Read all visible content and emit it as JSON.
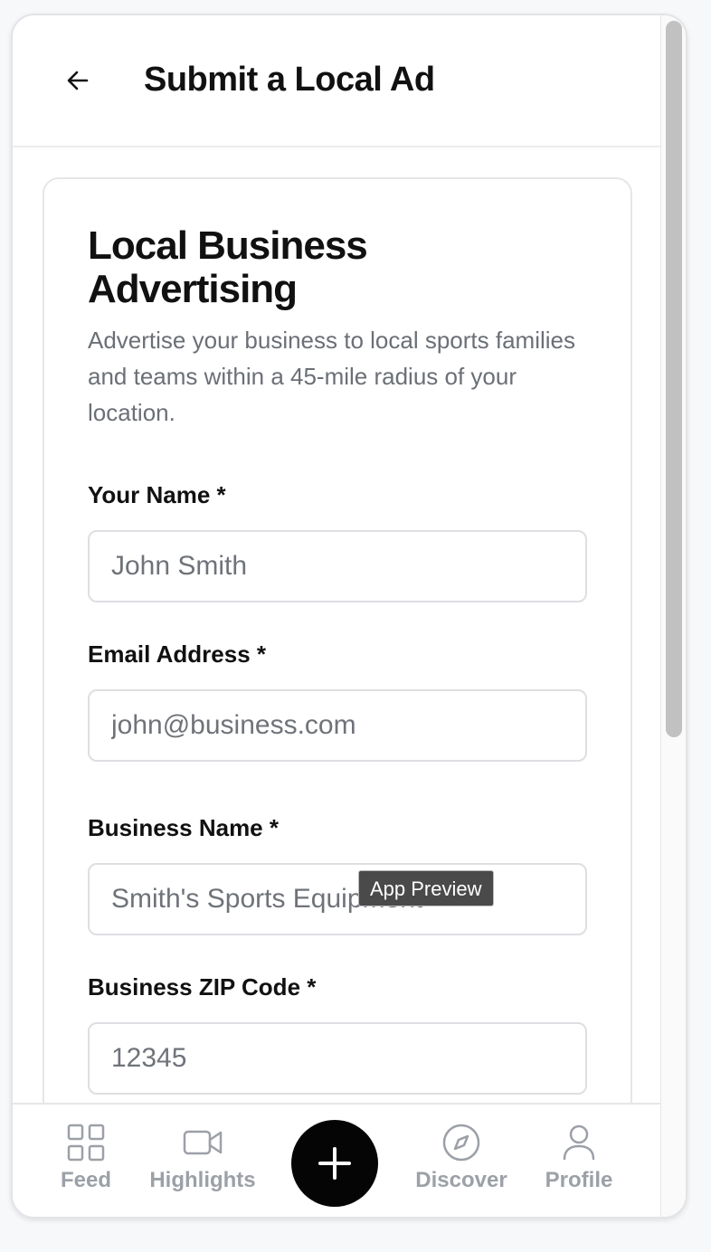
{
  "header": {
    "title": "Submit a Local Ad"
  },
  "card": {
    "title": "Local Business Advertising",
    "description": "Advertise your business to local sports families and teams within a 45-mile radius of your location."
  },
  "form": {
    "your_name": {
      "label": "Your Name *",
      "placeholder": "John Smith"
    },
    "email": {
      "label": "Email Address *",
      "placeholder": "john@business.com"
    },
    "business_name": {
      "label": "Business Name *",
      "placeholder": "Smith's Sports Equipment"
    },
    "zip": {
      "label": "Business ZIP Code *",
      "placeholder": "12345"
    }
  },
  "tooltip": {
    "text": "App Preview"
  },
  "nav": {
    "items": [
      {
        "label": "Feed",
        "icon": "grid-icon"
      },
      {
        "label": "Highlights",
        "icon": "video-camera-icon"
      },
      {
        "label": "Discover",
        "icon": "compass-icon"
      },
      {
        "label": "Profile",
        "icon": "user-icon"
      }
    ],
    "fab_icon": "plus-icon"
  },
  "colors": {
    "primary": "#050505",
    "muted": "#9ca0a7",
    "border": "#dedfe3"
  }
}
